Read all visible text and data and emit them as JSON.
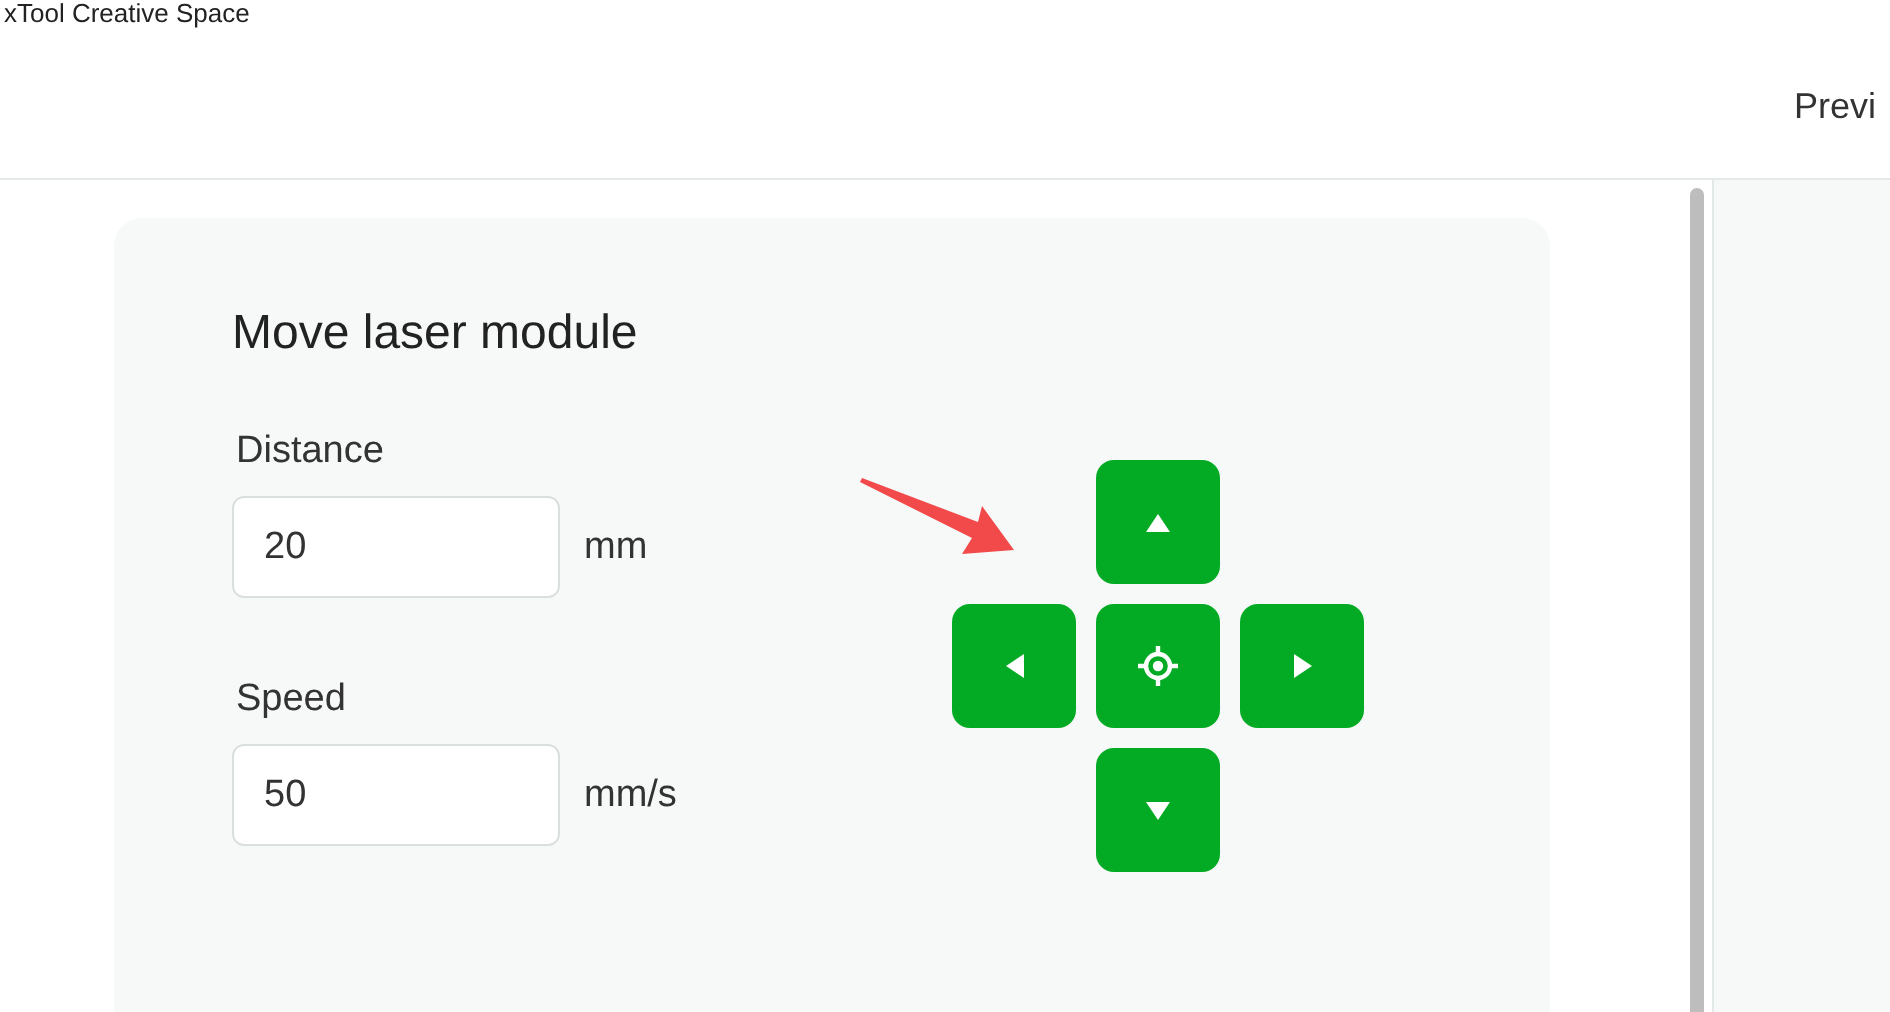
{
  "window": {
    "title": "xTool Creative Space"
  },
  "header": {
    "action": "Previ"
  },
  "panel": {
    "title": "Move laser module",
    "fields": [
      {
        "label": "Distance",
        "value": "20",
        "unit": "mm"
      },
      {
        "label": "Speed",
        "value": "50",
        "unit": "mm/s"
      }
    ],
    "jog_buttons": [
      {
        "kind": "up"
      },
      {
        "kind": "left"
      },
      {
        "kind": "home"
      },
      {
        "kind": "right"
      },
      {
        "kind": "down"
      }
    ]
  }
}
